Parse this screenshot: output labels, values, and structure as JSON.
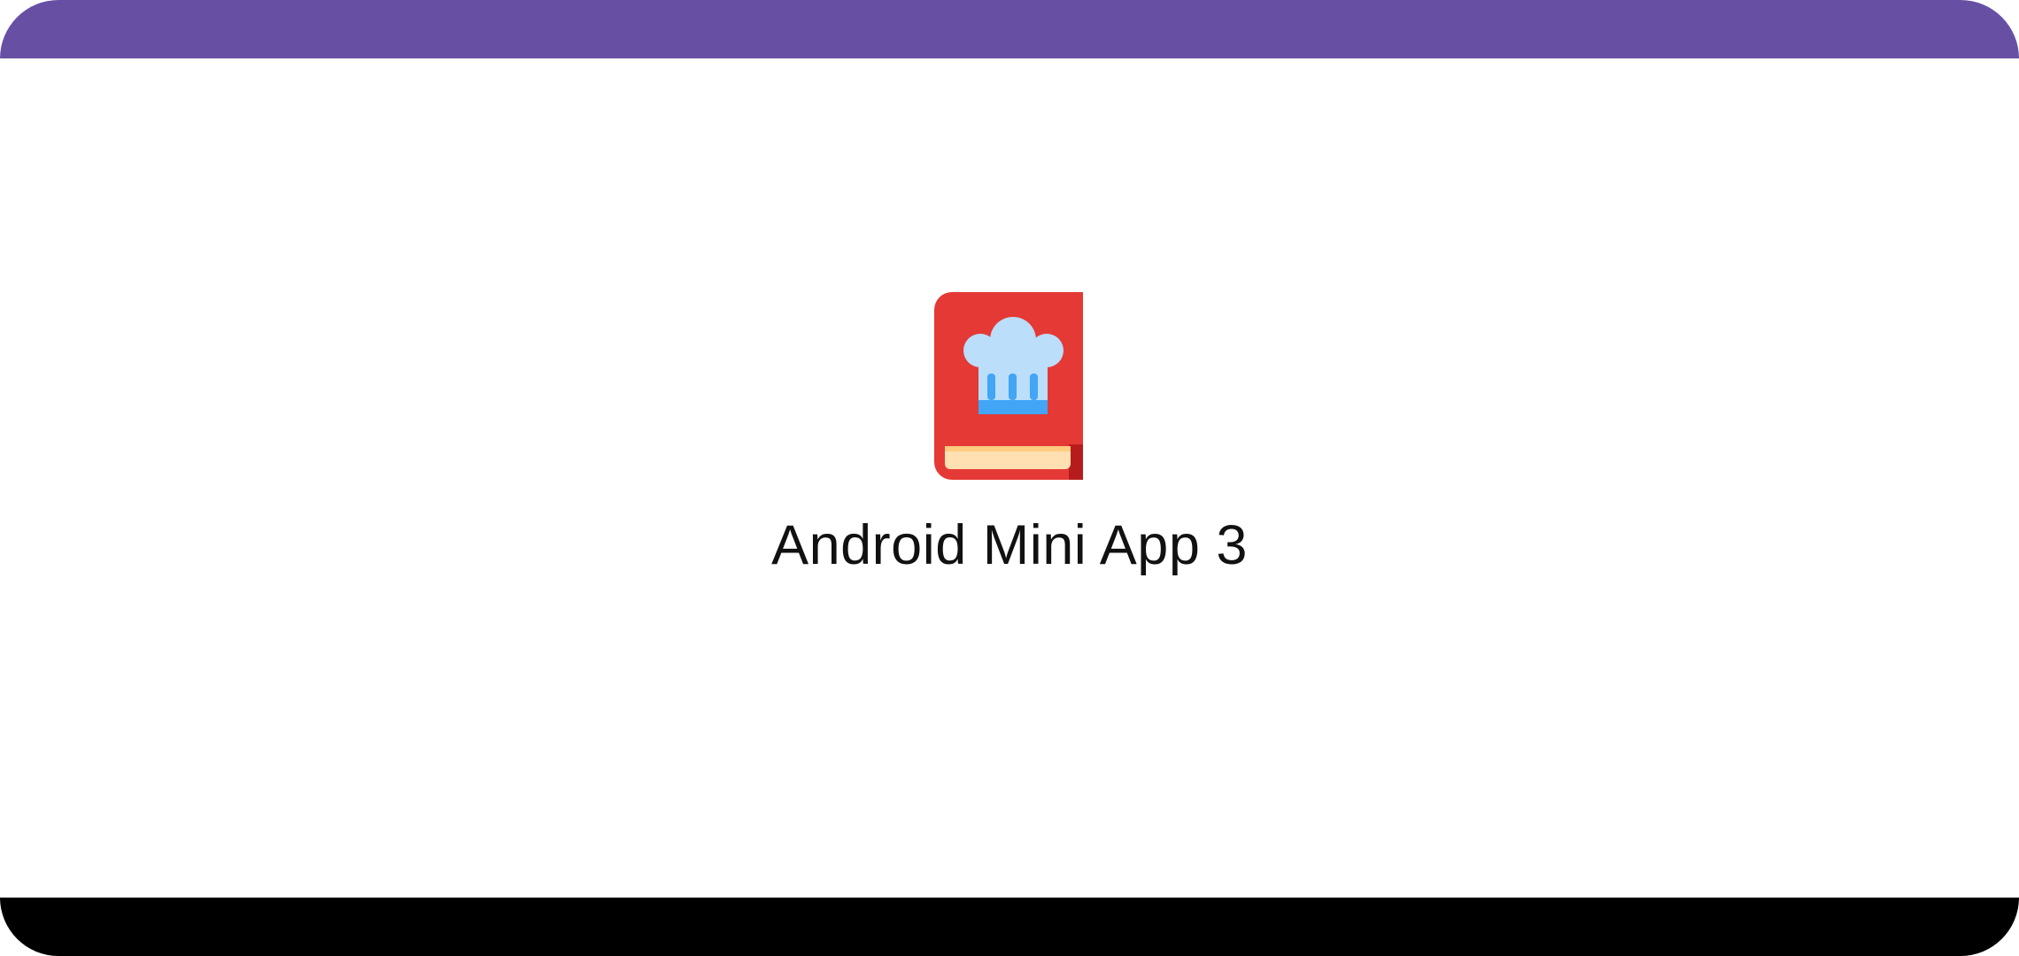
{
  "app": {
    "title": "Android Mini App 3",
    "icon": "chef-hat-cookbook-icon"
  },
  "colors": {
    "status_bar": "#6750A4",
    "background": "#FFFFFF",
    "nav_bar": "#000000",
    "book_cover": "#E53935",
    "book_spine": "#B71C1C",
    "pages": "#FFE0B2",
    "hat_light": "#BBDEFB",
    "hat_accent": "#42A5F5"
  }
}
